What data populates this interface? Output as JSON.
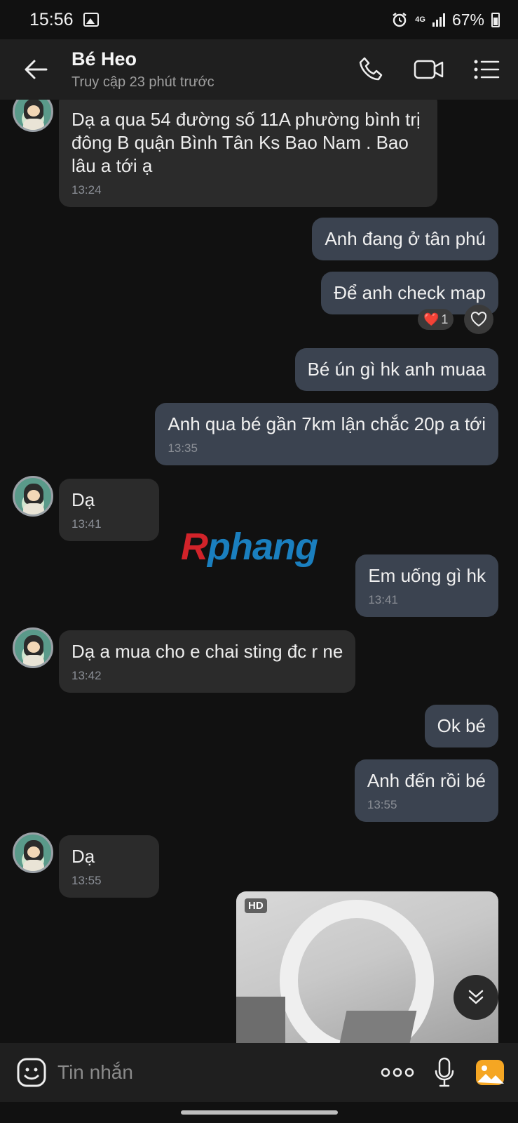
{
  "status_bar": {
    "time": "15:56",
    "network": "4G",
    "battery": "67%"
  },
  "header": {
    "contact_name": "Bé Heo",
    "last_seen": "Truy cập 23 phút trước",
    "icons": [
      "back-arrow-icon",
      "phone-icon",
      "video-call-icon",
      "menu-list-icon"
    ]
  },
  "messages": [
    {
      "side": "in",
      "text": "Dạ a qua 54 đường số 11A phường bình trị đông B quận Bình Tân Ks Bao Nam . Bao lâu a tới ạ",
      "time": "13:24"
    },
    {
      "side": "out",
      "text": "Anh đang ở tân phú"
    },
    {
      "side": "out",
      "text": "Để anh check map",
      "reaction": {
        "emoji": "❤️",
        "count": "1"
      }
    },
    {
      "side": "out",
      "text": "Bé ún gì hk anh muaa"
    },
    {
      "side": "out",
      "text": "Anh qua bé gần 7km lận chắc 20p a tới",
      "time": "13:35"
    },
    {
      "side": "in",
      "text": "Dạ",
      "time": "13:41"
    },
    {
      "side": "out",
      "text": "Em uống gì hk",
      "time": "13:41"
    },
    {
      "side": "in",
      "text": "Dạ a mua cho e chai sting đc r ne",
      "time": "13:42"
    },
    {
      "side": "out",
      "text": "Ok bé"
    },
    {
      "side": "out",
      "text": "Anh đến rồi bé",
      "time": "13:55"
    },
    {
      "side": "in",
      "text": "Dạ",
      "time": "13:55"
    }
  ],
  "media": {
    "badge": "HD"
  },
  "watermark": {
    "first": "R",
    "rest": "phang"
  },
  "composer": {
    "placeholder": "Tin nhắn"
  },
  "colors": {
    "background": "#111111",
    "incoming_bubble": "#2b2b2b",
    "outgoing_bubble": "#3b4350",
    "header": "#1f1f1f"
  }
}
